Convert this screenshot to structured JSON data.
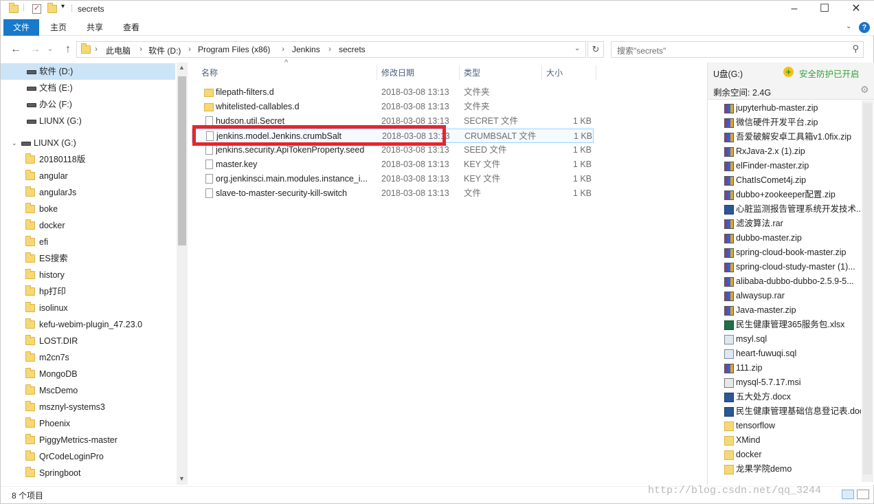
{
  "window": {
    "title": "secrets"
  },
  "ribbon": {
    "tabs": [
      "文件",
      "主页",
      "共享",
      "查看"
    ],
    "help": "?"
  },
  "address": {
    "crumbs": [
      "此电脑",
      "软件 (D:)",
      "Program Files (x86)",
      "Jenkins",
      "secrets"
    ],
    "search_placeholder": "搜索\"secrets\""
  },
  "nav": {
    "drives": [
      {
        "label": "软件 (D:)",
        "selected": true
      },
      {
        "label": "文档 (E:)"
      },
      {
        "label": "办公 (F:)"
      },
      {
        "label": "LIUNX (G:)"
      }
    ],
    "root": "LIUNX (G:)",
    "folders": [
      "20180118版",
      "angular",
      "angularJs",
      "boke",
      "docker",
      "efi",
      "ES搜索",
      "history",
      "hp打印",
      "isolinux",
      "kefu-webim-plugin_47.23.0",
      "LOST.DIR",
      "m2cn7s",
      "MongoDB",
      "MscDemo",
      "msznyl-systems3",
      "Phoenix",
      "PiggyMetrics-master",
      "QrCodeLoginPro",
      "Springboot"
    ]
  },
  "columns": {
    "name": "名称",
    "date": "修改日期",
    "type": "类型",
    "size": "大小"
  },
  "files": [
    {
      "name": "filepath-filters.d",
      "date": "2018-03-08 13:13",
      "type": "文件夹",
      "size": "",
      "kind": "folder"
    },
    {
      "name": "whitelisted-callables.d",
      "date": "2018-03-08 13:13",
      "type": "文件夹",
      "size": "",
      "kind": "folder"
    },
    {
      "name": "hudson.util.Secret",
      "date": "2018-03-08 13:13",
      "type": "SECRET 文件",
      "size": "1 KB",
      "kind": "file"
    },
    {
      "name": "jenkins.model.Jenkins.crumbSalt",
      "date": "2018-03-08 13:13",
      "type": "CRUMBSALT 文件",
      "size": "1 KB",
      "kind": "file",
      "selected": true
    },
    {
      "name": "jenkins.security.ApiTokenProperty.seed",
      "date": "2018-03-08 13:13",
      "type": "SEED 文件",
      "size": "1 KB",
      "kind": "file"
    },
    {
      "name": "master.key",
      "date": "2018-03-08 13:13",
      "type": "KEY 文件",
      "size": "1 KB",
      "kind": "file"
    },
    {
      "name": "org.jenkinsci.main.modules.instance_i...",
      "date": "2018-03-08 13:13",
      "type": "KEY 文件",
      "size": "1 KB",
      "kind": "file"
    },
    {
      "name": "slave-to-master-security-kill-switch",
      "date": "2018-03-08 13:13",
      "type": "文件",
      "size": "1 KB",
      "kind": "file"
    }
  ],
  "right_pane": {
    "drive": "U盘(G:)",
    "protect": "安全防护已开启",
    "space": "剩余空间: 2.4G",
    "items": [
      {
        "name": "jupyterhub-master.zip",
        "icon": "zip"
      },
      {
        "name": "微信硬件开发平台.zip",
        "icon": "zip"
      },
      {
        "name": "吾爱破解安卓工具箱v1.0fix.zip",
        "icon": "zip"
      },
      {
        "name": "RxJava-2.x (1).zip",
        "icon": "zip"
      },
      {
        "name": "elFinder-master.zip",
        "icon": "zip"
      },
      {
        "name": "ChatIsComet4j.zip",
        "icon": "zip"
      },
      {
        "name": "dubbo+zookeeper配置.zip",
        "icon": "zip"
      },
      {
        "name": "心脏监测报告管理系统开发技术...",
        "icon": "doc"
      },
      {
        "name": "滤波算法.rar",
        "icon": "zip"
      },
      {
        "name": "dubbo-master.zip",
        "icon": "zip"
      },
      {
        "name": "spring-cloud-book-master.zip",
        "icon": "zip"
      },
      {
        "name": "spring-cloud-study-master (1)...",
        "icon": "zip"
      },
      {
        "name": "alibaba-dubbo-dubbo-2.5.9-5...",
        "icon": "zip"
      },
      {
        "name": "alwaysup.rar",
        "icon": "zip"
      },
      {
        "name": "Java-master.zip",
        "icon": "zip"
      },
      {
        "name": "民生健康管理365服务包.xlsx",
        "icon": "xls"
      },
      {
        "name": "msyl.sql",
        "icon": "sql"
      },
      {
        "name": "heart-fuwuqi.sql",
        "icon": "sql"
      },
      {
        "name": "111.zip",
        "icon": "zip"
      },
      {
        "name": "mysql-5.7.17.msi",
        "icon": "msi"
      },
      {
        "name": "五大处方.docx",
        "icon": "doc"
      },
      {
        "name": "民生健康管理基础信息登记表.doc",
        "icon": "doc"
      },
      {
        "name": "tensorflow",
        "icon": "folder"
      },
      {
        "name": "XMind",
        "icon": "folder"
      },
      {
        "name": "docker",
        "icon": "folder"
      },
      {
        "name": "龙果学院demo",
        "icon": "folder"
      }
    ]
  },
  "status": {
    "count": "8 个项目"
  },
  "watermark": "http://blog.csdn.net/qq_3244"
}
